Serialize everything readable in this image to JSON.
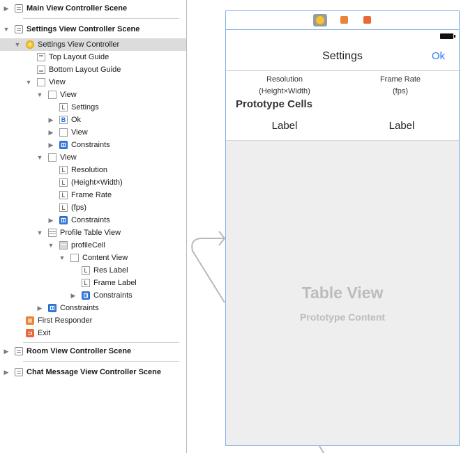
{
  "outline": {
    "scenes": [
      {
        "title": "Main View Controller Scene"
      },
      {
        "title": "Settings View Controller Scene"
      },
      {
        "title": "Room View Controller Scene"
      },
      {
        "title": "Chat Message View Controller Scene"
      }
    ],
    "items": {
      "settings_vc": "Settings View Controller",
      "top_layout_guide": "Top Layout Guide",
      "bottom_layout_guide": "Bottom Layout Guide",
      "view_root": "View",
      "view_nav": "View",
      "label_settings": "Settings",
      "button_ok": "Ok",
      "view_nav_inner": "View",
      "constraints_nav": "Constraints",
      "view_header": "View",
      "label_resolution": "Resolution",
      "label_height_width": "(Height×Width)",
      "label_frame_rate": "Frame Rate",
      "label_fps": "(fps)",
      "constraints_header": "Constraints",
      "profile_table_view": "Profile Table View",
      "profile_cell": "profileCell",
      "content_view": "Content View",
      "res_label": "Res Label",
      "frame_label": "Frame Label",
      "constraints_cell": "Constraints",
      "constraints_root": "Constraints",
      "first_responder": "First Responder",
      "exit": "Exit"
    },
    "icon_glyphs": {
      "label": "L",
      "button": "B"
    }
  },
  "canvas": {
    "dock_icons": [
      "view-controller-icon",
      "first-responder-icon",
      "exit-icon"
    ],
    "nav_title": "Settings",
    "nav_ok": "Ok",
    "header_resolution": "Resolution",
    "header_resolution_sub": "(Height×Width)",
    "header_frame_rate": "Frame Rate",
    "header_frame_rate_sub": "(fps)",
    "prototype_cells_title": "Prototype Cells",
    "cell_label_1": "Label",
    "cell_label_2": "Label",
    "table_view_title": "Table View",
    "table_view_subtitle": "Prototype Content",
    "colors": {
      "accent": "#2d7cf6",
      "selection": "#dcdcdc",
      "scene_border": "#7fb0e8"
    }
  }
}
